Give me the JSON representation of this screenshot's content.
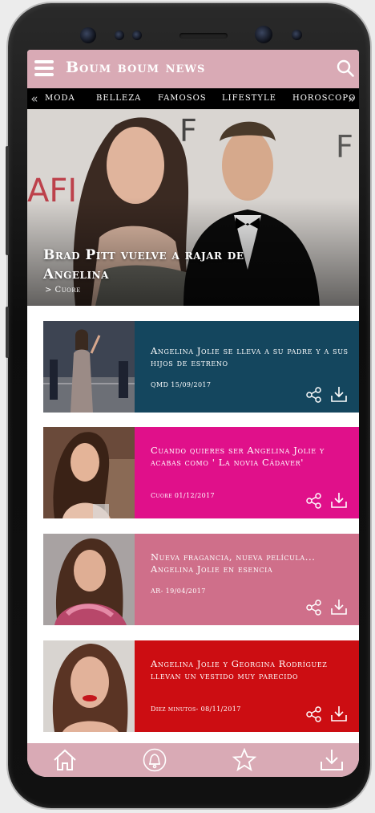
{
  "app": {
    "brand": "Boum boum news"
  },
  "categories": {
    "prev_arrow": "«",
    "next_arrow": "»",
    "items": [
      "MODA",
      "BELLEZA",
      "FAMOSOS",
      "LIFESTYLE",
      "HOROSCOPO"
    ]
  },
  "hero": {
    "title": "Brad Pitt vuelve a rajar de Angelina",
    "category": "> Cuore"
  },
  "articles": [
    {
      "title": "Angelina Jolie se lleva a su padre y a sus hijos de estreno",
      "meta": "QMD 15/09/2017",
      "color": "#14465e"
    },
    {
      "title": "Cuando quieres ser Angelina Jolie y acabas como ' La novia Cádaver'",
      "meta": "Cuore 01/12/2017",
      "color": "#e0108a"
    },
    {
      "title": "Nueva fragancia, nueva película... Angelina Jolie en esencia",
      "meta": "AR- 19/04/2017",
      "color": "#cf6f8a"
    },
    {
      "title": "Angelina Jolie y Georgina Rodríguez llevan un vestido muy parecido",
      "meta": "Diez minutos- 08/11/2017",
      "color": "#cc0d12"
    }
  ],
  "colors": {
    "header": "#d9aab5",
    "category_bar": "#000000"
  },
  "icons": {
    "menu": "hamburger-icon",
    "search": "search-icon",
    "share": "share-icon",
    "download": "download-icon",
    "nav": [
      "home-icon",
      "bell-icon",
      "star-icon",
      "download-icon"
    ]
  }
}
